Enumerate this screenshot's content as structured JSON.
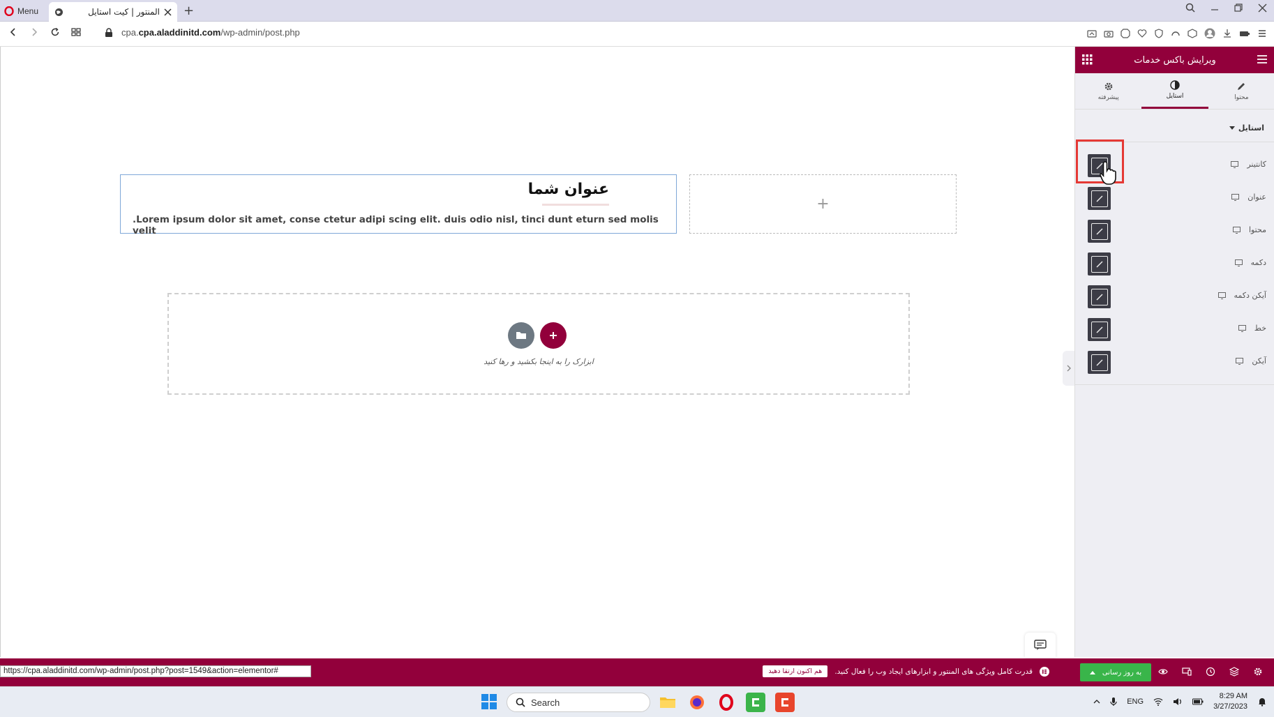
{
  "browser": {
    "menu_label": "Menu",
    "tab_title": "المنتور | کیت استایل",
    "new_tab_symbol": "+",
    "url_host": "cpa.aladdinitd.com",
    "url_path": "/wp-admin/post.php",
    "url_prefix": "cpa."
  },
  "canvas": {
    "heading": "عنوان شما",
    "body_text": ".Lorem ipsum dolor sit amet, conse ctetur adipi scing elit. duis odio nisl, tinci dunt eturn sed molis velit",
    "add_symbol": "+",
    "drop_text": "ابزارک را به اینجا بکشید و رها کنید"
  },
  "panel": {
    "title": "ویرایش باکس خدمات",
    "tabs": [
      {
        "label": "محتوا",
        "icon": "pencil-icon"
      },
      {
        "label": "استایل",
        "icon": "contrast-icon"
      },
      {
        "label": "پیشرفته",
        "icon": "gear-icon"
      }
    ],
    "active_tab": "استایل",
    "section": "استایل",
    "controls": [
      {
        "label": "کانتینر"
      },
      {
        "label": "عنوان"
      },
      {
        "label": "محتوا"
      },
      {
        "label": "دکمه"
      },
      {
        "label": "آیکن دکمه"
      },
      {
        "label": "خط"
      },
      {
        "label": "آیکن"
      }
    ]
  },
  "footer": {
    "status_url": "https://cpa.aladdinitd.com/wp-admin/post.php?post=1549&action=elementor#",
    "promo_text": "قدرت کامل ویژگی های المنتور و ابزارهای ایجاد وب را فعال کنید.",
    "promo_button": "هم اکنون ارتقا دهید",
    "publish_label": "به روز رسانی"
  },
  "taskbar": {
    "search_label": "Search",
    "language": "ENG",
    "time": "8:29 AM",
    "date": "3/27/2023"
  },
  "colors": {
    "brand": "#92003b",
    "publish": "#39b54a",
    "highlight": "#e53935"
  }
}
